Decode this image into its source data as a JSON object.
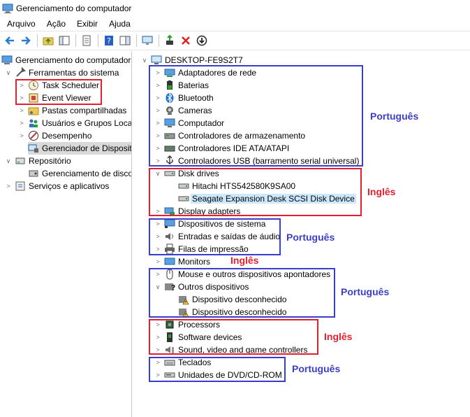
{
  "window": {
    "title": "Gerenciamento do computador"
  },
  "menu": [
    "Arquivo",
    "Ação",
    "Exibir",
    "Ajuda"
  ],
  "left_tree": {
    "root": "Gerenciamento do computador",
    "tools": "Ferramentas do sistema",
    "task_scheduler": "Task Scheduler",
    "event_viewer": "Event Viewer",
    "shared_folders": "Pastas compartilhadas",
    "users_groups": "Usuários e Grupos Loca",
    "performance": "Desempenho",
    "device_manager": "Gerenciador de Disposit",
    "storage": "Repositório",
    "disk_mgmt": "Gerenciamento de disco",
    "services": "Serviços e aplicativos"
  },
  "device_tree": {
    "computer": "DESKTOP-FE9S2T7",
    "network_adapters": "Adaptadores de rede",
    "batteries": "Baterias",
    "bluetooth": "Bluetooth",
    "cameras": "Cameras",
    "computer_node": "Computador",
    "storage_ctrl": "Controladores de armazenamento",
    "ide_ctrl": "Controladores IDE ATA/ATAPI",
    "usb_ctrl": "Controladores USB (barramento serial universal)",
    "disk_drives": "Disk drives",
    "disk1": "Hitachi HTS542580K9SA00",
    "disk2": "Seagate Expansion Desk SCSI Disk Device",
    "display_adapters": "Display adapters",
    "system_devices": "Dispositivos de sistema",
    "audio_io": "Entradas e saídas de áudio",
    "print_queues": "Filas de impressão",
    "monitors": "Monitors",
    "mouse": "Mouse e outros dispositivos apontadores",
    "other_devices": "Outros dispositivos",
    "unknown1": "Dispositivo desconhecido",
    "unknown2": "Dispositivo desconhecido",
    "processors": "Processors",
    "software_devices": "Software devices",
    "sound": "Sound, video and game controllers",
    "keyboards": "Teclados",
    "dvd": "Unidades de DVD/CD-ROM"
  },
  "annotations": {
    "pt1": "Português",
    "en1": "Inglês",
    "pt2": "Português",
    "en2": "Inglês",
    "pt3": "Português",
    "en3": "Inglês",
    "pt4": "Português"
  },
  "colors": {
    "annotation_blue": "#3b3ec8",
    "annotation_red": "#e02030",
    "selection": "#cce8ff"
  }
}
